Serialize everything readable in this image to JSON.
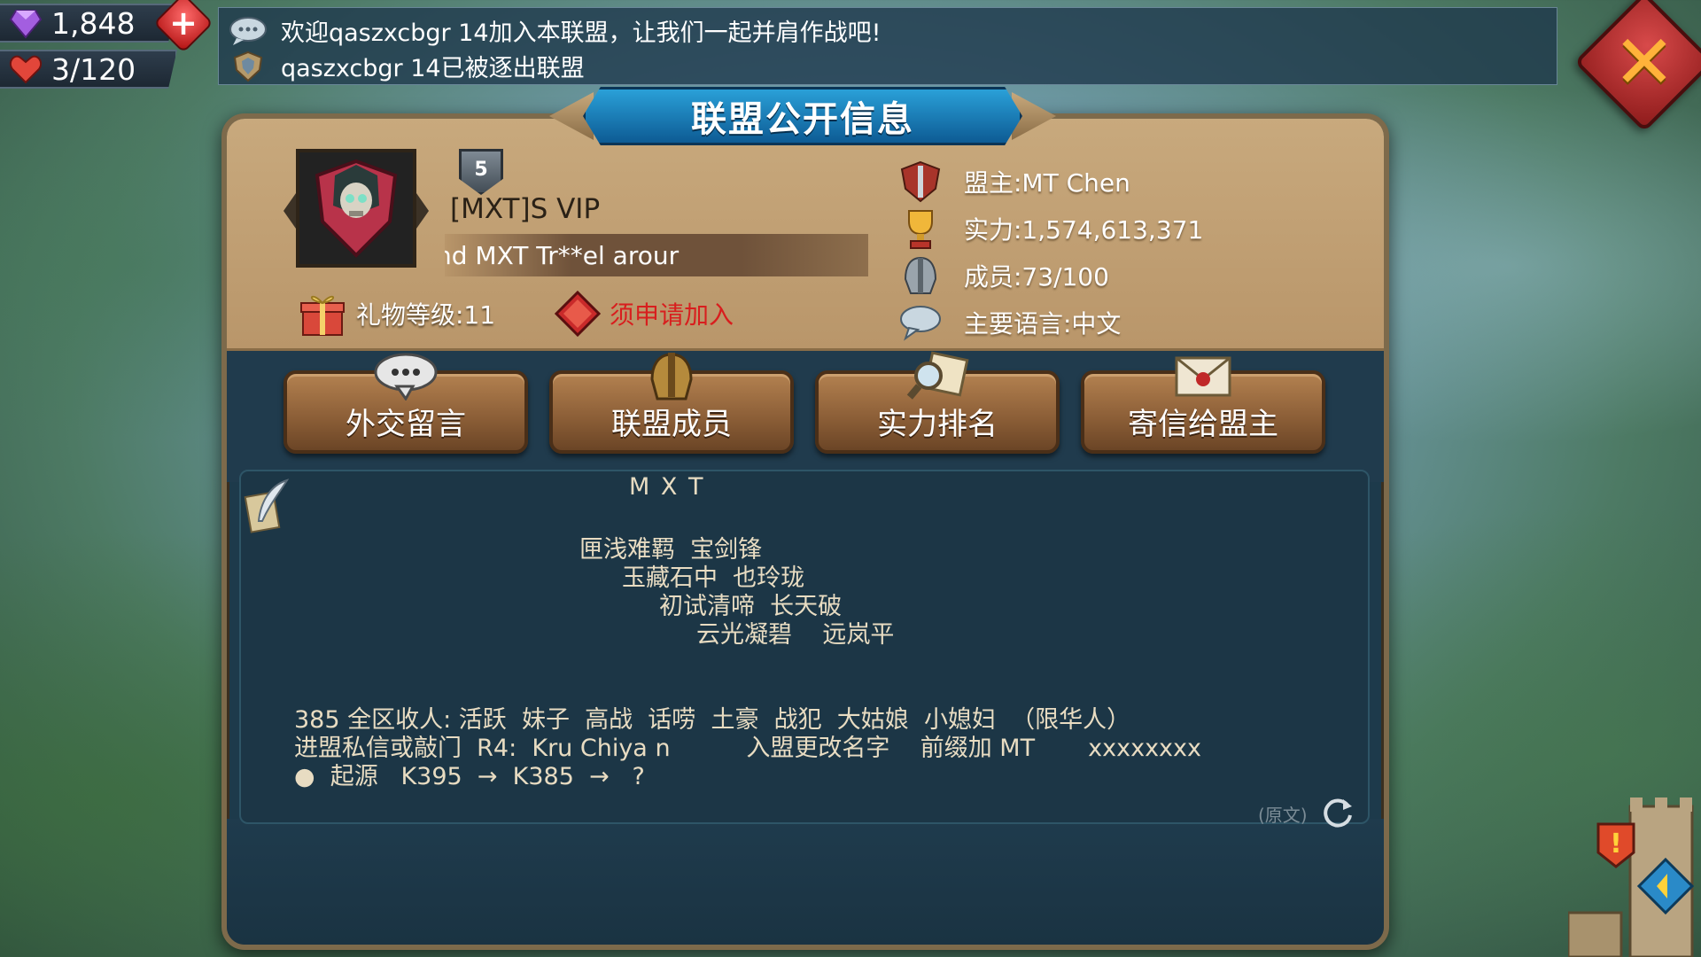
{
  "resources": {
    "gems": "1,848",
    "stamina": "3/120"
  },
  "notifications": [
    "欢迎qaszxcbgr 14加入本联盟，让我们一起并肩作战吧!",
    "qaszxcbgr 14已被逐出联盟"
  ],
  "panel": {
    "title": "联盟公开信息"
  },
  "guild": {
    "level": "5",
    "name": "[MXT]S   VIP",
    "motto": "nd                        MXT     Tr**el arour",
    "gift_level": "礼物等级:11",
    "join_policy": "须申请加入",
    "leader": "盟主:MT   Chen",
    "power": "实力:1,574,613,371",
    "members": "成员:73/100",
    "language": "主要语言:中文"
  },
  "actions": {
    "diplomacy": "外交留言",
    "members": "联盟成员",
    "ranking": "实力排名",
    "mail_leader": "寄信给盟主"
  },
  "description": {
    "l1": "M X T",
    "l2": "匣浅难羁  宝剑锋",
    "l3": "玉藏石中  也玲珑",
    "l4": "初试清啼  长天破",
    "l5": "云光凝碧    远岚平",
    "l6": "385 全区收人: 活跃  妹子  高战  话唠  土豪  战犯  大姑娘  小媳妇  （限华人）",
    "l7": "进盟私信或敲门  R4:  Kru Chiya n          入盟更改名字    前缀加 MT       xxxxxxxx",
    "l8": "●  起源   K395  →  K385  →   ?"
  },
  "original_label": "(原文)",
  "colors": {
    "panel_top": "#c8a97d",
    "panel_body": "#1d3a4b",
    "title_blue": "#1b7fbf",
    "button_brown": "#8a5d36",
    "apply_red": "#d81e1e"
  }
}
